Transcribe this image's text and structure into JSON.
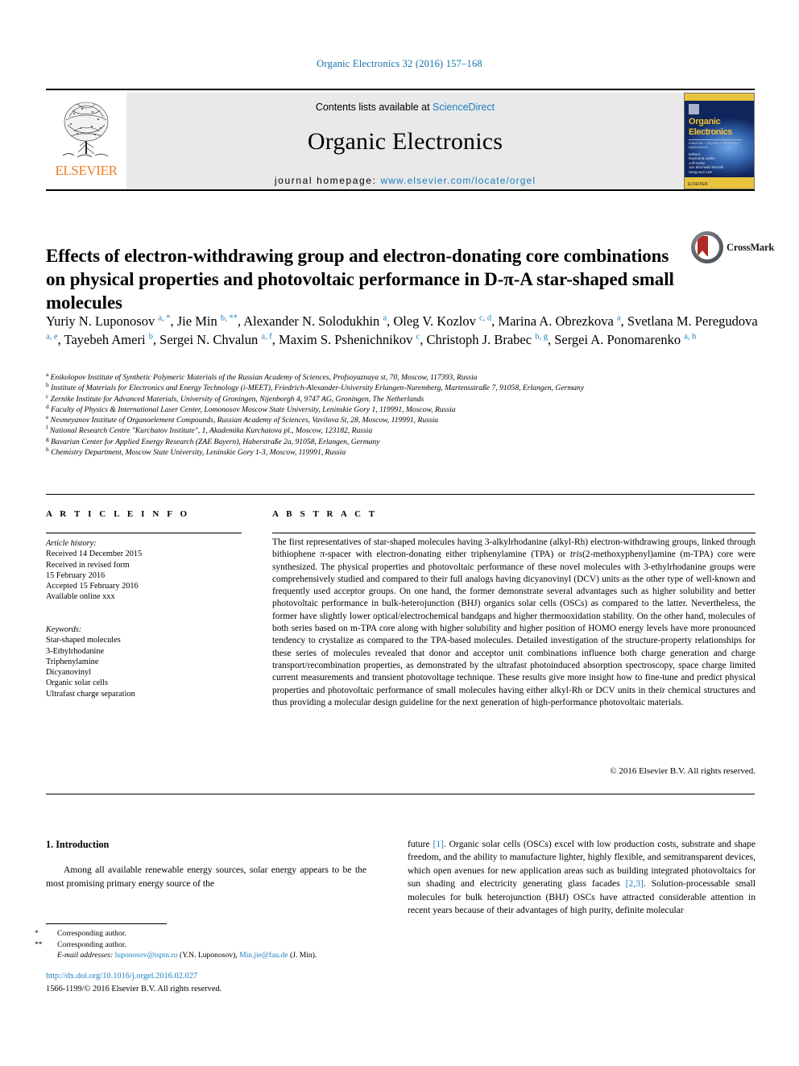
{
  "running_head": "Organic Electronics 32 (2016) 157–168",
  "masthead": {
    "contents_prefix": "Contents lists available at ",
    "sciencedirect": "ScienceDirect",
    "journal_title": "Organic Electronics",
    "homepage_label": "journal homepage: ",
    "homepage_url": "www.elsevier.com/locate/orgel",
    "publisher": "ELSEVIER",
    "cover": {
      "line1": "Organic",
      "line2": "Electronics",
      "subtitle": "materials • physics • chemistry • applications",
      "editors": "Editors:\nRaymond Leeks\nJoff Krebs\nJan Blochwitz-Nimoth\nSeog-woo Lee",
      "bottom": "ELSEVIER"
    }
  },
  "article": {
    "title": "Effects of electron-withdrawing group and electron-donating core combinations on physical properties and photovoltaic performance in D-π-A star-shaped small molecules",
    "crossmark_label": "CrossMark",
    "authors_html": "Yuriy N. Luponosov <sup>a, *</sup>, Jie Min <sup>b, **</sup>, Alexander N. Solodukhin <sup>a</sup>, Oleg V. Kozlov <sup>c, d</sup>, Marina A. Obrezkova <sup>a</sup>, Svetlana M. Peregudova <sup>a, e</sup>, Tayebeh Ameri <sup>b</sup>, Sergei N. Chvalun <sup>a, f</sup>, Maxim S. Pshenichnikov <sup>c</sup>, Christoph J. Brabec <sup>b, g</sup>, Sergei A. Ponomarenko <sup>a, h</sup>",
    "affiliations": [
      {
        "mark": "a",
        "text": "Enikolopov Institute of Synthetic Polymeric Materials of the Russian Academy of Sciences, Profsoyuznaya st, 70, Moscow, 117393, Russia"
      },
      {
        "mark": "b",
        "text": "Institute of Materials for Electronics and Energy Technology (i-MEET), Friedrich-Alexander-University Erlangen-Nuremberg, Martensstraße 7, 91058, Erlangen, Germany"
      },
      {
        "mark": "c",
        "text": "Zernike Institute for Advanced Materials, University of Groningen, Nijenborgh 4, 9747 AG, Groningen, The Netherlands"
      },
      {
        "mark": "d",
        "text": "Faculty of Physics & International Laser Center, Lomonosov Moscow State University, Leninskie Gory 1, 119991, Moscow, Russia"
      },
      {
        "mark": "e",
        "text": "Nesmeyanov Institute of Organoelement Compounds, Russian Academy of Sciences, Vavilova St, 28, Moscow, 119991, Russia"
      },
      {
        "mark": "f",
        "text": "National Research Centre \"Kurchatov Institute\", 1, Akademika Kurchatova pl., Moscow, 123182, Russia"
      },
      {
        "mark": "g",
        "text": "Bavarian Center for Applied Energy Research (ZAE Bayern), Haberstraße 2a, 91058, Erlangen, Germany"
      },
      {
        "mark": "h",
        "text": "Chemistry Department, Moscow State University, Leninskie Gory 1-3, Moscow, 119991, Russia"
      }
    ]
  },
  "article_info": {
    "heading": "A R T I C L E   I N F O",
    "history_label": "Article history:",
    "history": [
      "Received 14 December 2015",
      "Received in revised form",
      "15 February 2016",
      "Accepted 15 February 2016",
      "Available online xxx"
    ],
    "keywords_label": "Keywords:",
    "keywords": [
      "Star-shaped molecules",
      "3-Ethylrhodanine",
      "Triphenylamine",
      "Dicyanovinyl",
      "Organic solar cells",
      "Ultrafast charge separation"
    ]
  },
  "abstract": {
    "heading": "A B S T R A C T",
    "paragraph_html": "The first representatives of star-shaped molecules having 3-alkylrhodanine (alkyl-Rh) electron-withdrawing groups, linked through bithiophene π-spacer with electron-donating either triphenylamine (TPA) or <span class=\"it\">tris</span>(2-methoxyphenyl)amine (m-TPA) core were synthesized. The physical properties and photovoltaic performance of these novel molecules with 3-ethylrhodanine groups were comprehensively studied and compared to their full analogs having dicyanovinyl (DCV) units as the other type of well-known and frequently used acceptor groups. On one hand, the former demonstrate several advantages such as higher solubility and better photovoltaic performance in bulk-heterojunction (BHJ) organics solar cells (OSCs) as compared to the latter. Nevertheless, the former have slightly lower optical/electrochemical bandgaps and higher thermooxidation stability. On the other hand, molecules of both series based on m-TPA core along with higher solubility and higher position of HOMO energy levels have more pronounced tendency to crystalize as compared to the TPA-based molecules. Detailed investigation of the structure-property relationships for these series of molecules revealed that donor and acceptor unit combinations influence both charge generation and charge transport/recombination properties, as demonstrated by the ultrafast photoinduced absorption spectroscopy, space charge limited current measurements and transient photovoltage technique. These results give more insight how to fine-tune and predict physical properties and photovoltaic performance of small molecules having either alkyl-Rh or DCV units in their chemical structures and thus providing a molecular design guideline for the next generation of high-performance photovoltaic materials.",
    "copyright": "© 2016 Elsevier B.V. All rights reserved."
  },
  "body": {
    "section_number_title": "1.  Introduction",
    "left_paragraph": "Among all available renewable energy sources, solar energy appears to be the most promising primary energy source of the",
    "right_paragraph_html": "future <span class=\"ref\">[1]</span>. Organic solar cells (OSCs) excel with low production costs, substrate and shape freedom, and the ability to manufacture lighter, highly flexible, and semitransparent devices, which open avenues for new application areas such as building integrated photovoltaics for sun shading and electricity generating glass facades <span class=\"ref\">[2,3]</span>. Solution-processable small molecules for bulk heterojunction (BHJ) OSCs have attracted considerable attention in recent years because of their advantages of high purity, definite molecular"
  },
  "footnotes": {
    "corresponding_1": "Corresponding author.",
    "corresponding_2": "Corresponding author.",
    "email_label": "E-mail addresses:",
    "email_1": "luponosov@ispm.ru",
    "email_1_owner": "(Y.N. Luponosov),",
    "email_2": "Min.jie@fau.de",
    "email_2_owner": "(J. Min).",
    "doi": "http://dx.doi.org/10.1016/j.orgel.2016.02.027",
    "issn_line": "1566-1199/© 2016 Elsevier B.V. All rights reserved."
  }
}
